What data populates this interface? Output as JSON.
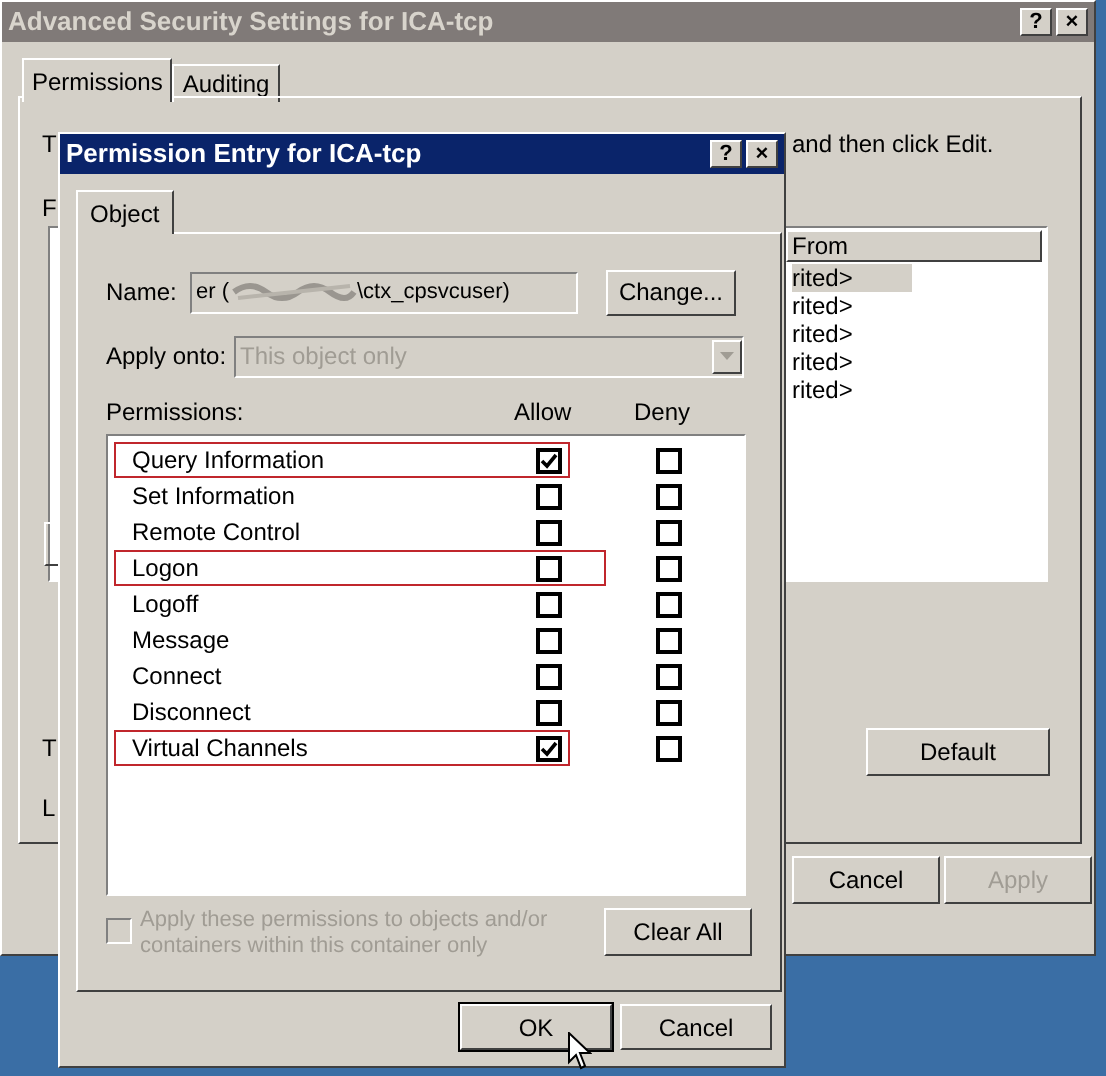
{
  "back_window": {
    "title": "Advanced Security Settings for ICA-tcp",
    "title_buttons": [
      "?",
      "×"
    ],
    "tabs": [
      {
        "label": "Permissions",
        "selected": true
      },
      {
        "label": "Auditing",
        "selected": false
      }
    ],
    "fragments": [
      "T",
      "F",
      "T",
      "L"
    ],
    "intro_tail": "and then click Edit.",
    "table": {
      "column": "From",
      "rows": [
        {
          "text": "rited>",
          "selected": true
        },
        {
          "text": "rited>",
          "selected": false
        },
        {
          "text": "rited>",
          "selected": false
        },
        {
          "text": "rited>",
          "selected": false
        },
        {
          "text": "rited>",
          "selected": false
        }
      ]
    },
    "default_button": "Default",
    "buttons": [
      {
        "label": "Cancel",
        "disabled": false
      },
      {
        "label": "Apply",
        "disabled": true
      }
    ]
  },
  "dialog": {
    "title": "Permission Entry for ICA-tcp",
    "title_buttons": [
      "?",
      "×"
    ],
    "tabs": [
      {
        "label": "Object",
        "selected": true
      }
    ],
    "name": {
      "label": "Name:",
      "value_start": "er (",
      "value_end": "\\ctx_cpsvcuser)"
    },
    "change_button": "Change...",
    "apply_onto": {
      "label": "Apply onto:",
      "value": "This object only",
      "disabled": true
    },
    "permissions": {
      "label": "Permissions:",
      "columns": [
        "Allow",
        "Deny"
      ],
      "rows": [
        {
          "name": "Query Information",
          "allow": true,
          "deny": false,
          "highlighted": true
        },
        {
          "name": "Set Information",
          "allow": false,
          "deny": false,
          "highlighted": false
        },
        {
          "name": "Remote Control",
          "allow": false,
          "deny": false,
          "highlighted": false
        },
        {
          "name": "Logon",
          "allow": false,
          "deny": false,
          "highlighted": true
        },
        {
          "name": "Logoff",
          "allow": false,
          "deny": false,
          "highlighted": false
        },
        {
          "name": "Message",
          "allow": false,
          "deny": false,
          "highlighted": false
        },
        {
          "name": "Connect",
          "allow": false,
          "deny": false,
          "highlighted": false
        },
        {
          "name": "Disconnect",
          "allow": false,
          "deny": false,
          "highlighted": false
        },
        {
          "name": "Virtual Channels",
          "allow": true,
          "deny": false,
          "highlighted": true
        }
      ]
    },
    "apply_children": {
      "label": "Apply these permissions to objects and/or containers within this container only",
      "checked": false,
      "disabled": true
    },
    "clear_all_button": "Clear All",
    "buttons": [
      {
        "label": "OK",
        "default": true
      },
      {
        "label": "Cancel",
        "default": false
      }
    ]
  }
}
